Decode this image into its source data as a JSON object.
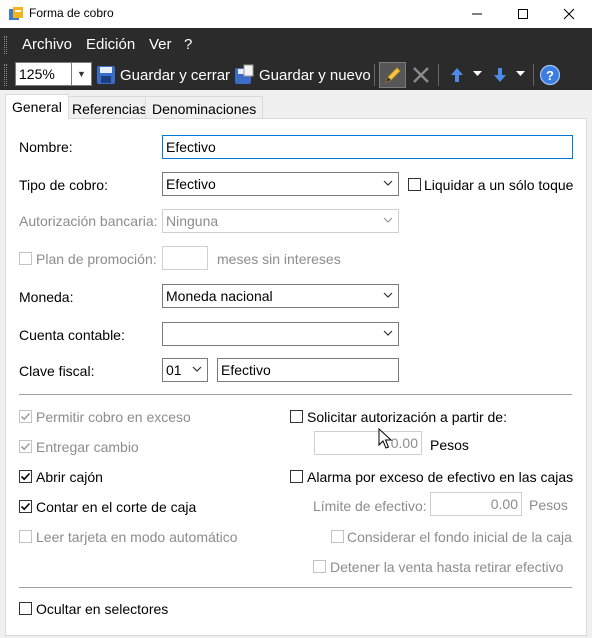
{
  "window": {
    "title": "Forma de cobro",
    "minimize_glyph": "—",
    "maximize_glyph": "☐",
    "close_glyph": "✕"
  },
  "menu": {
    "items": [
      "Archivo",
      "Edición",
      "Ver",
      "?"
    ]
  },
  "toolbar": {
    "zoom_value": "125%",
    "save_close_label": "Guardar y cerrar",
    "save_new_label": "Guardar y nuevo"
  },
  "tabs": [
    "General",
    "Referencias",
    "Denominaciones"
  ],
  "form": {
    "nombre": {
      "label": "Nombre:",
      "value": "Efectivo"
    },
    "tipo_cobro": {
      "label": "Tipo de cobro:",
      "value": "Efectivo"
    },
    "liquidar": {
      "label": "Liquidar a un sólo toque",
      "checked": false
    },
    "autorizacion": {
      "label": "Autorización bancaria:",
      "value": "Ninguna"
    },
    "plan_promocion": {
      "label": "Plan de promoción:",
      "value": "",
      "suffix": "meses sin intereses"
    },
    "moneda": {
      "label": "Moneda:",
      "value": "Moneda nacional"
    },
    "cuenta_contable": {
      "label": "Cuenta contable:",
      "value": ""
    },
    "clave_fiscal": {
      "label": "Clave fiscal:",
      "code": "01",
      "description": "Efectivo"
    }
  },
  "options": {
    "permitir_exceso": {
      "label": "Permitir cobro en exceso",
      "checked": true,
      "enabled": false
    },
    "entregar_cambio": {
      "label": "Entregar cambio",
      "checked": true,
      "enabled": false
    },
    "abrir_cajon": {
      "label": "Abrir cajón",
      "checked": true,
      "enabled": true
    },
    "contar_corte": {
      "label": "Contar en el corte de caja",
      "checked": true,
      "enabled": true
    },
    "leer_tarjeta": {
      "label": "Leer tarjeta en modo automático",
      "checked": false,
      "enabled": false
    },
    "solicitar_autorizacion": {
      "label": "Solicitar autorización a partir de:",
      "checked": false,
      "amount": "0.00",
      "unit": "Pesos"
    },
    "alarma_exceso": {
      "label": "Alarma por exceso de efectivo en las cajas",
      "checked": false
    },
    "limite_efectivo": {
      "label": "Límite de efectivo:",
      "amount": "0.00",
      "unit": "Pesos"
    },
    "considerar_fondo": {
      "label": "Considerar el fondo inicial de la caja",
      "checked": false,
      "enabled": false
    },
    "detener_venta": {
      "label": "Detener la venta hasta retirar efectivo",
      "checked": false,
      "enabled": false
    },
    "ocultar_selectores": {
      "label": "Ocultar en selectores",
      "checked": false
    }
  },
  "colors": {
    "toolbar_bg": "#2b2b2b",
    "focus_border": "#0078d7",
    "disabled_text": "#8c8c8c"
  }
}
